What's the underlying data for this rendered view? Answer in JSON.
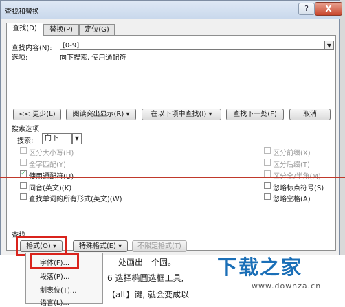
{
  "dialog": {
    "title": "查找和替换",
    "help": "?",
    "close": "X"
  },
  "tabs": [
    {
      "label": "查找(D)",
      "active": true
    },
    {
      "label": "替换(P)",
      "active": false
    },
    {
      "label": "定位(G)",
      "active": false
    }
  ],
  "find": {
    "label": "查找内容(N):",
    "value": "[0-9]",
    "options_label": "选项:",
    "options_value": "向下搜索, 使用通配符"
  },
  "buttons": {
    "less": "<< 更少(L)",
    "reading_highlight": "阅读突出显示(R) ▾",
    "find_in": "在以下项中查找(I) ▾",
    "find_next": "查找下一处(F)",
    "cancel": "取消"
  },
  "search_options": {
    "header": "搜索选项",
    "search_label": "搜索:",
    "search_value": "向下"
  },
  "checkboxes_left": [
    {
      "label": "区分大小写(H)",
      "checked": false,
      "disabled": true
    },
    {
      "label": "全字匹配(Y)",
      "checked": false,
      "disabled": true
    },
    {
      "label": "使用通配符(U)",
      "checked": true,
      "disabled": false
    },
    {
      "label": "同音(英文)(K)",
      "checked": false,
      "disabled": false
    },
    {
      "label": "查找单词的所有形式(英文)(W)",
      "checked": false,
      "disabled": false
    }
  ],
  "checkboxes_right": [
    {
      "label": "区分前缀(X)",
      "checked": false,
      "disabled": true
    },
    {
      "label": "区分后缀(T)",
      "checked": false,
      "disabled": true
    },
    {
      "label": "区分全/半角(M)",
      "checked": false,
      "disabled": true
    },
    {
      "label": "忽略标点符号(S)",
      "checked": false,
      "disabled": false
    },
    {
      "label": "忽略空格(A)",
      "checked": false,
      "disabled": false
    }
  ],
  "find_section": {
    "header": "查找",
    "format": "格式(O) ▾",
    "special": "特殊格式(E) ▾",
    "no_format": "不限定格式(T)"
  },
  "menu": {
    "items": [
      "字体(F)...",
      "段落(P)...",
      "制表位(T)...",
      "语言(L)..."
    ]
  },
  "document": {
    "line1": "处画出一个圆。",
    "line2": "6 选择椭圆选框工具,",
    "line3": "【alt】键, 就会变成以"
  },
  "watermark": {
    "brand": "下载之家",
    "url": "www.downza.cn"
  },
  "colors": {
    "accent_red": "#d9231c",
    "brand_blue": "#1b6fb7"
  }
}
